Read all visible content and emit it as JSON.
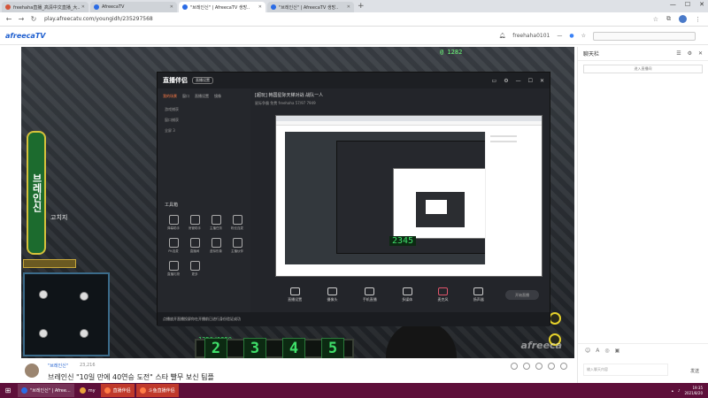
{
  "browser": {
    "tabs": [
      {
        "label": "freehaha直播_高清中文直播_大..",
        "active": false,
        "fav_color": "#d4543a"
      },
      {
        "label": "AfreecaTV",
        "active": false,
        "fav_color": "#2a6be5"
      },
      {
        "label": "\"브레인신\" | AfreecaTV 생방..",
        "active": true,
        "fav_color": "#2a6be5"
      },
      {
        "label": "\"브레인신\" | AfreecaTV 생방..",
        "active": false,
        "fav_color": "#2a6be5"
      }
    ],
    "new_tab": "+",
    "window_controls": [
      "—",
      "☐",
      "✕"
    ],
    "url": "play.afreecatv.com/youngidh/235297568"
  },
  "afreeca": {
    "logo": "afreecaTV",
    "user": "freehaha0101",
    "user_menu": "—"
  },
  "video": {
    "streamer_tag": "브레인신",
    "overlay_name": "고치지",
    "hp": "1250/1250",
    "digits": [
      "2",
      "3",
      "4",
      "5"
    ],
    "watermark": "afreeca",
    "top_score": "@ 1282"
  },
  "app": {
    "logo": "直播伴侣",
    "badge": "直播设置",
    "tabs": [
      "我的场景",
      "窗口",
      "直播设置",
      "镜像"
    ],
    "sources": [
      "游戏捕获",
      "窗口捕获",
      "全屏 3"
    ],
    "tools_title": "工具箱",
    "tools": [
      "弹幕助手",
      "房管助手",
      "主播任务",
      "粉丝连麦",
      "PK连麦",
      "直播间",
      "虚拟形象",
      "主播伙伴",
      "直播礼物",
      "更多"
    ],
    "stream_title": "[超玩] 韩国星际天梯对战 战队一人",
    "stream_sub": "星际争霸  免费  freehaha  57/97  7949",
    "controls": [
      "直播设置",
      "摄像头",
      "手机直播",
      "多媒体",
      "麦克风",
      "扬声器"
    ],
    "go_live": "开始直播",
    "bottom_tip": "点播放开直播投屏你在开播前已进行身份验证成功"
  },
  "title": {
    "channel": "\"브레인신\"",
    "viewers": "23,216",
    "text": "브레인신 \"10일 만에 40연승 도전\" 스타 빨무 보신 팀플"
  },
  "chat": {
    "title": "聊天栏",
    "join_btn": "进入直播间",
    "input_placeholder": "输入聊天内容",
    "send": "发送"
  },
  "taskbar": {
    "items": [
      {
        "label": "\"브레인신\" | Afree...",
        "color": "#2a6be5"
      },
      {
        "label": "my",
        "color": "#e8a23a"
      },
      {
        "label": "直播伴侣",
        "color": "#d4543a"
      },
      {
        "label": "斗鱼直播伴侣",
        "color": "#d4543a"
      }
    ],
    "time": "19:35",
    "date": "2021/8/20"
  }
}
